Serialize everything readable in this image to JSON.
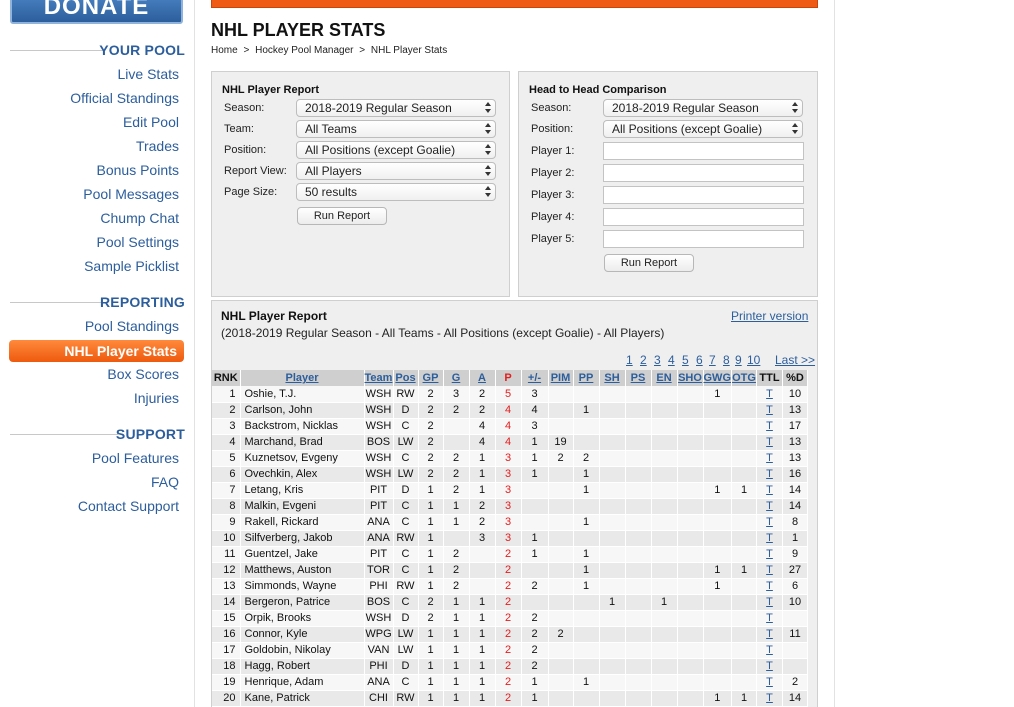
{
  "sidebar": {
    "donate": "DONATE",
    "sections": [
      {
        "title": "YOUR POOL",
        "items": [
          "Live Stats",
          "Official Standings",
          "Edit Pool",
          "Trades",
          "Bonus Points",
          "Pool Messages",
          "Chump Chat",
          "Pool Settings",
          "Sample Picklist"
        ]
      },
      {
        "title": "REPORTING",
        "items": [
          "Pool Standings",
          "NHL Player Stats",
          "Box Scores",
          "Injuries"
        ],
        "active": "NHL Player Stats"
      },
      {
        "title": "SUPPORT",
        "items": [
          "Pool Features",
          "FAQ",
          "Contact Support"
        ]
      }
    ]
  },
  "page": {
    "title": "NHL PLAYER STATS",
    "breadcrumb": [
      "Home",
      ">",
      "Hockey Pool Manager",
      ">",
      "NHL Player Stats"
    ]
  },
  "report_form": {
    "title": "NHL Player Report",
    "fields": [
      {
        "label": "Season:",
        "value": "2018-2019 Regular Season"
      },
      {
        "label": "Team:",
        "value": "All Teams"
      },
      {
        "label": "Position:",
        "value": "All Positions (except Goalie)"
      },
      {
        "label": "Report View:",
        "value": "All Players"
      },
      {
        "label": "Page Size:",
        "value": "50 results"
      }
    ],
    "button": "Run Report"
  },
  "h2h_form": {
    "title": "Head to Head Comparison",
    "selects": [
      {
        "label": "Season:",
        "value": "2018-2019 Regular Season"
      },
      {
        "label": "Position:",
        "value": "All Positions (except Goalie)"
      }
    ],
    "players": [
      {
        "label": "Player 1:",
        "value": ""
      },
      {
        "label": "Player 2:",
        "value": ""
      },
      {
        "label": "Player 3:",
        "value": ""
      },
      {
        "label": "Player 4:",
        "value": ""
      },
      {
        "label": "Player 5:",
        "value": ""
      }
    ],
    "button": "Run Report"
  },
  "report": {
    "title": "NHL Player Report",
    "printer_link": "Printer version",
    "subtitle": "(2018-2019 Regular Season - All Teams - All Positions (except Goalie) - All Players)",
    "pager": [
      "1",
      "2",
      "3",
      "4",
      "5",
      "6",
      "7",
      "8",
      "9",
      "10",
      "Last >>"
    ],
    "columns": [
      "RNK",
      "Player",
      "Team",
      "Pos",
      "GP",
      "G",
      "A",
      "P",
      "+/-",
      "PIM",
      "PP",
      "SH",
      "PS",
      "EN",
      "SHO",
      "GWG",
      "OTG",
      "TTL",
      "%D"
    ],
    "rows": [
      [
        "1",
        "Oshie, T.J.",
        "WSH",
        "RW",
        "2",
        "3",
        "2",
        "5",
        "3",
        "",
        "",
        "",
        "",
        "",
        "",
        "1",
        "",
        "T",
        "10"
      ],
      [
        "2",
        "Carlson, John",
        "WSH",
        "D",
        "2",
        "2",
        "2",
        "4",
        "4",
        "",
        "1",
        "",
        "",
        "",
        "",
        "",
        "",
        "T",
        "13"
      ],
      [
        "3",
        "Backstrom, Nicklas",
        "WSH",
        "C",
        "2",
        "",
        "4",
        "4",
        "3",
        "",
        "",
        "",
        "",
        "",
        "",
        "",
        "",
        "T",
        "17"
      ],
      [
        "4",
        "Marchand, Brad",
        "BOS",
        "LW",
        "2",
        "",
        "4",
        "4",
        "1",
        "19",
        "",
        "",
        "",
        "",
        "",
        "",
        "",
        "T",
        "13"
      ],
      [
        "5",
        "Kuznetsov, Evgeny",
        "WSH",
        "C",
        "2",
        "2",
        "1",
        "3",
        "1",
        "2",
        "2",
        "",
        "",
        "",
        "",
        "",
        "",
        "T",
        "13"
      ],
      [
        "6",
        "Ovechkin, Alex",
        "WSH",
        "LW",
        "2",
        "2",
        "1",
        "3",
        "1",
        "",
        "1",
        "",
        "",
        "",
        "",
        "",
        "",
        "T",
        "16"
      ],
      [
        "7",
        "Letang, Kris",
        "PIT",
        "D",
        "1",
        "2",
        "1",
        "3",
        "",
        "",
        "1",
        "",
        "",
        "",
        "",
        "1",
        "1",
        "T",
        "14"
      ],
      [
        "8",
        "Malkin, Evgeni",
        "PIT",
        "C",
        "1",
        "1",
        "2",
        "3",
        "",
        "",
        "",
        "",
        "",
        "",
        "",
        "",
        "",
        "T",
        "14"
      ],
      [
        "9",
        "Rakell, Rickard",
        "ANA",
        "C",
        "1",
        "1",
        "2",
        "3",
        "",
        "",
        "1",
        "",
        "",
        "",
        "",
        "",
        "",
        "T",
        "8"
      ],
      [
        "10",
        "Silfverberg, Jakob",
        "ANA",
        "RW",
        "1",
        "",
        "3",
        "3",
        "1",
        "",
        "",
        "",
        "",
        "",
        "",
        "",
        "",
        "T",
        "1"
      ],
      [
        "11",
        "Guentzel, Jake",
        "PIT",
        "C",
        "1",
        "2",
        "",
        "2",
        "1",
        "",
        "1",
        "",
        "",
        "",
        "",
        "",
        "",
        "T",
        "9"
      ],
      [
        "12",
        "Matthews, Auston",
        "TOR",
        "C",
        "1",
        "2",
        "",
        "2",
        "",
        "",
        "1",
        "",
        "",
        "",
        "",
        "1",
        "1",
        "T",
        "27"
      ],
      [
        "13",
        "Simmonds, Wayne",
        "PHI",
        "RW",
        "1",
        "2",
        "",
        "2",
        "2",
        "",
        "1",
        "",
        "",
        "",
        "",
        "1",
        "",
        "T",
        "6"
      ],
      [
        "14",
        "Bergeron, Patrice",
        "BOS",
        "C",
        "2",
        "1",
        "1",
        "2",
        "",
        "",
        "",
        "1",
        "",
        "1",
        "",
        "",
        "",
        "T",
        "10"
      ],
      [
        "15",
        "Orpik, Brooks",
        "WSH",
        "D",
        "2",
        "1",
        "1",
        "2",
        "2",
        "",
        "",
        "",
        "",
        "",
        "",
        "",
        "",
        "T",
        ""
      ],
      [
        "16",
        "Connor, Kyle",
        "WPG",
        "LW",
        "1",
        "1",
        "1",
        "2",
        "2",
        "2",
        "",
        "",
        "",
        "",
        "",
        "",
        "",
        "T",
        "11"
      ],
      [
        "17",
        "Goldobin, Nikolay",
        "VAN",
        "LW",
        "1",
        "1",
        "1",
        "2",
        "2",
        "",
        "",
        "",
        "",
        "",
        "",
        "",
        "",
        "T",
        ""
      ],
      [
        "18",
        "Hagg, Robert",
        "PHI",
        "D",
        "1",
        "1",
        "1",
        "2",
        "2",
        "",
        "",
        "",
        "",
        "",
        "",
        "",
        "",
        "T",
        ""
      ],
      [
        "19",
        "Henrique, Adam",
        "ANA",
        "C",
        "1",
        "1",
        "1",
        "2",
        "1",
        "",
        "1",
        "",
        "",
        "",
        "",
        "",
        "",
        "T",
        "2"
      ],
      [
        "20",
        "Kane, Patrick",
        "CHI",
        "RW",
        "1",
        "1",
        "1",
        "2",
        "1",
        "",
        "",
        "",
        "",
        "",
        "",
        "1",
        "1",
        "T",
        "14"
      ]
    ]
  },
  "colors": {
    "accent": "#ef5a14",
    "link": "#2c5e9c",
    "points": "#e41d1d"
  }
}
